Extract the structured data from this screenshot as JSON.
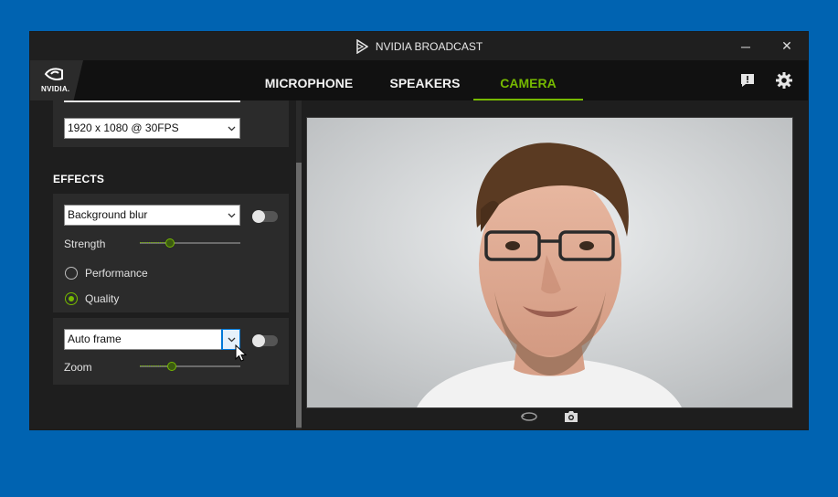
{
  "window": {
    "title": "NVIDIA BROADCAST",
    "minimize_label": "─",
    "close_label": "✕"
  },
  "brand": {
    "logo_text": "NVIDIA.",
    "icon": "nvidia-eye-logo"
  },
  "tabs": [
    {
      "label": "MICROPHONE",
      "active": false
    },
    {
      "label": "SPEAKERS",
      "active": false
    },
    {
      "label": "CAMERA",
      "active": true
    }
  ],
  "nav_icons": [
    "feedback-icon",
    "settings-gear-icon"
  ],
  "camera": {
    "resolution": "1920 x 1080 @ 30FPS"
  },
  "effects": {
    "title": "EFFECTS",
    "effect1": {
      "selected": "Background blur",
      "enabled": false,
      "slider_label": "Strength",
      "slider_value": 0.3,
      "options": [
        {
          "label": "Performance",
          "checked": false
        },
        {
          "label": "Quality",
          "checked": true
        }
      ]
    },
    "effect2": {
      "selected": "Auto frame",
      "enabled": false,
      "slider_label": "Zoom",
      "slider_value": 0.32
    }
  },
  "preview_toolbar": [
    "rotate-icon",
    "camera-snapshot-icon"
  ],
  "colors": {
    "accent": "#76b900",
    "desktop": "#0063b1",
    "window_bg": "#1e1e1e"
  }
}
